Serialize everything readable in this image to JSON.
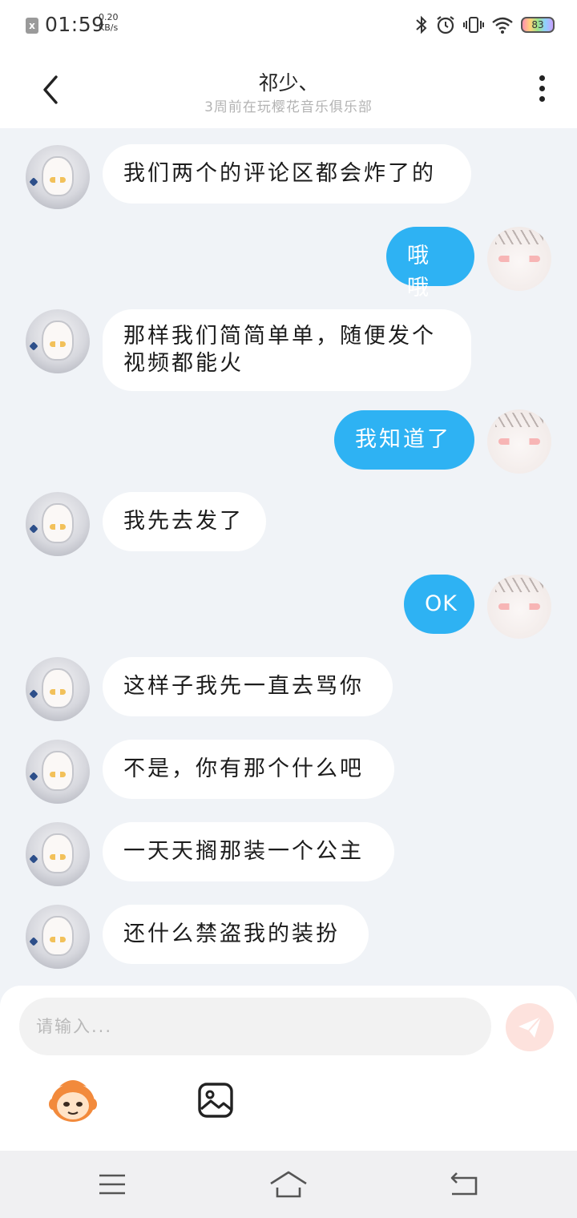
{
  "status_bar": {
    "sim_label": "x",
    "time": "01:59",
    "speed_value": "0.20",
    "speed_unit": "KB/s",
    "battery": "83",
    "icons": [
      "bluetooth-icon",
      "alarm-icon",
      "vibrate-icon",
      "wifi-icon",
      "battery-icon"
    ]
  },
  "header": {
    "title": "祁少、",
    "subtitle": "3周前在玩樱花音乐俱乐部"
  },
  "messages": [
    {
      "side": "in",
      "text": "我们两个的评论区都会炸了的"
    },
    {
      "side": "out",
      "text": "哦哦"
    },
    {
      "side": "in",
      "text": "那样我们简简单单，随便发个\n视频都能火"
    },
    {
      "side": "out",
      "text": "我知道了"
    },
    {
      "side": "in",
      "text": "我先去发了"
    },
    {
      "side": "out",
      "text": "OK"
    },
    {
      "side": "in",
      "text": "这样子我先一直去骂你"
    },
    {
      "side": "in",
      "text": "不是，你有那个什么吧"
    },
    {
      "side": "in",
      "text": "一天天搁那装一个公主"
    },
    {
      "side": "in",
      "text": "还什么禁盗我的装扮"
    }
  ],
  "composer": {
    "placeholder": "请输入...",
    "icons": [
      "send-icon",
      "emoji-icon",
      "image-icon"
    ]
  },
  "navbar": {
    "icons": [
      "menu-icon",
      "home-icon",
      "back-nav-icon"
    ]
  },
  "colors": {
    "outgoing_bubble": "#2eb2f3",
    "incoming_bubble": "#ffffff",
    "chat_background": "#f0f3f7"
  }
}
